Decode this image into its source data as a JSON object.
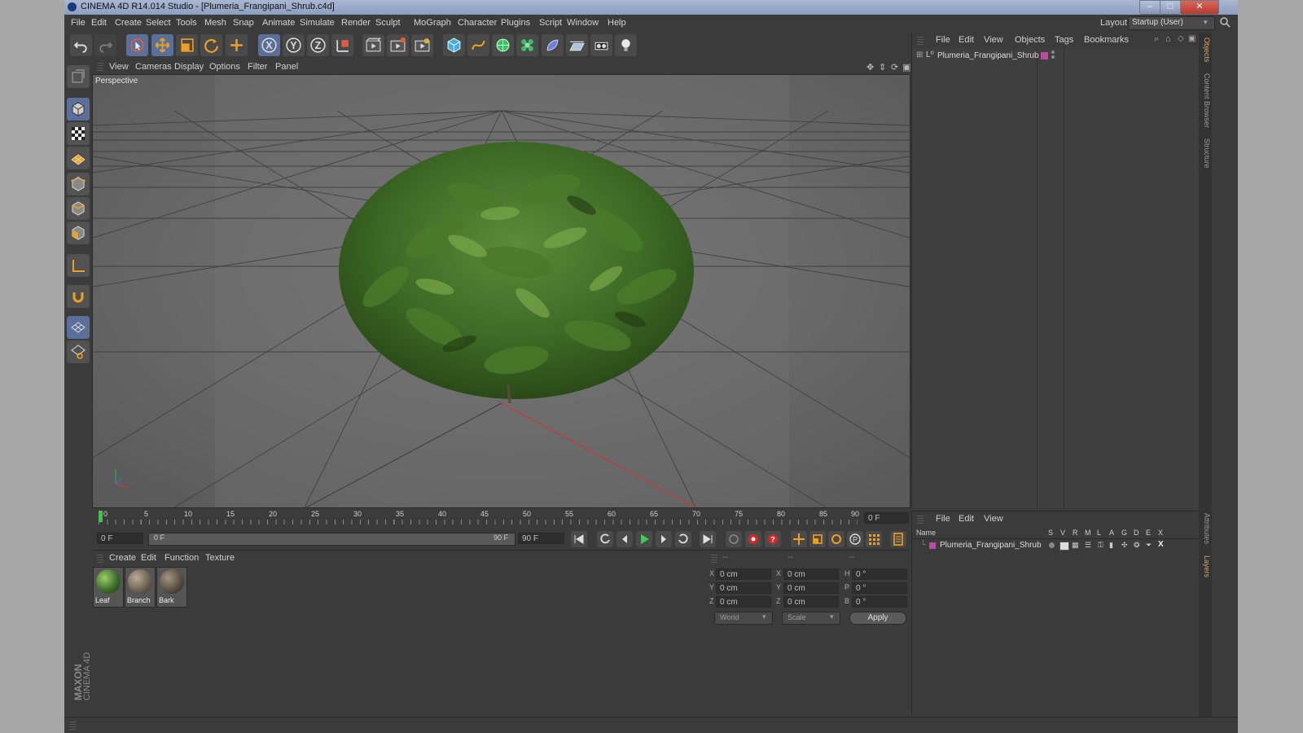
{
  "window": {
    "title": "CINEMA 4D R14.014 Studio - [Plumeria_Frangipani_Shrub.c4d]",
    "minimize": "–",
    "maximize": "□",
    "close": "✕"
  },
  "menubar": {
    "items": [
      "File",
      "Edit",
      "Create",
      "Select",
      "Tools",
      "Mesh",
      "Snap",
      "Animate",
      "Simulate",
      "Render",
      "Sculpt",
      "MoGraph",
      "Character",
      "Plugins",
      "Script",
      "Window",
      "Help"
    ],
    "layout_label": "Layout:",
    "layout_value": "Startup (User)"
  },
  "viewport": {
    "menu": [
      "View",
      "Cameras",
      "Display",
      "Options",
      "Filter",
      "Panel"
    ],
    "label": "Perspective"
  },
  "timeline": {
    "ticks": [
      "0",
      "5",
      "10",
      "15",
      "20",
      "25",
      "30",
      "35",
      "40",
      "45",
      "50",
      "55",
      "60",
      "65",
      "70",
      "75",
      "80",
      "85",
      "90"
    ],
    "current_frame": "0 F"
  },
  "playbar": {
    "start_field": "0 F",
    "range_start": "0 F",
    "range_end": "90 F",
    "end_field": "90 F"
  },
  "material_panel": {
    "menu": [
      "Create",
      "Edit",
      "Function",
      "Texture"
    ],
    "materials": [
      {
        "name": "Leaf",
        "color": "#3f6b2a"
      },
      {
        "name": "Branch",
        "color": "#6f6556"
      },
      {
        "name": "Bark",
        "color": "#5b5143"
      }
    ]
  },
  "coord_panel": {
    "headers": [
      "--",
      "--",
      "--"
    ],
    "rows": [
      {
        "a_label": "X",
        "a_val": "0 cm",
        "b_label": "X",
        "b_val": "0 cm",
        "c_label": "H",
        "c_val": "0 °"
      },
      {
        "a_label": "Y",
        "a_val": "0 cm",
        "b_label": "Y",
        "b_val": "0 cm",
        "c_label": "P",
        "c_val": "0 °"
      },
      {
        "a_label": "Z",
        "a_val": "0 cm",
        "b_label": "Z",
        "b_val": "0 cm",
        "c_label": "B",
        "c_val": "0 °"
      }
    ],
    "space_select": "World",
    "mode_select": "Scale",
    "apply": "Apply"
  },
  "object_manager": {
    "menu": [
      "File",
      "Edit",
      "View",
      "Objects",
      "Tags",
      "Bookmarks"
    ],
    "objects": [
      {
        "name": "Plumeria_Frangipani_Shrub",
        "layer_color": "#b44fa0"
      }
    ]
  },
  "layer_manager": {
    "menu": [
      "File",
      "Edit",
      "View"
    ],
    "columns": {
      "name": "Name",
      "flags": [
        "S",
        "V",
        "R",
        "M",
        "L",
        "A",
        "G",
        "D",
        "E",
        "X"
      ]
    },
    "layers": [
      {
        "name": "Plumeria_Frangipani_Shrub",
        "color": "#b44fa0"
      }
    ]
  },
  "side_tabs": [
    "Objects",
    "Content Browser",
    "Structure",
    "Attributes",
    "Layers"
  ],
  "branding": {
    "line1": "MAXON",
    "line2": "CINEMA 4D"
  },
  "colors": {
    "active_blue": "#5a6f9a",
    "axis_red": "#c43a3a",
    "axis_green": "#3aa04a",
    "layer_magenta": "#b44fa0"
  }
}
